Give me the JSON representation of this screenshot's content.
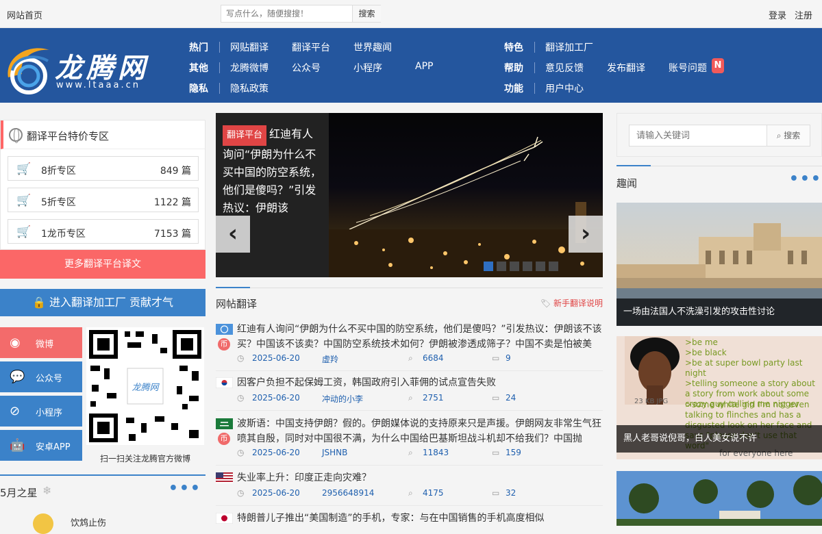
{
  "topbar": {
    "home": "网站首页",
    "search_placeholder": "写点什么，随便搜搜！",
    "search_button": "搜索",
    "login": "登录",
    "register": "注册"
  },
  "logo": {
    "title": "龙腾网",
    "url": "www.ltaaa.cn"
  },
  "nav": {
    "row1": [
      "热门",
      "网贴翻译",
      "翻译平台",
      "世界趣闻",
      "特色",
      "翻译加工厂"
    ],
    "row2": [
      "其他",
      "龙腾微博",
      "公众号",
      "小程序",
      "APP",
      "帮助",
      "意见反馈",
      "发布翻译",
      "账号问题"
    ],
    "row3": [
      "隐私",
      "隐私政策",
      "功能",
      "用户中心"
    ],
    "badge": "N"
  },
  "promo": {
    "title": "翻译平台特价专区",
    "items": [
      {
        "name": "8折专区",
        "count": "849 篇"
      },
      {
        "name": "5折专区",
        "count": "1122 篇"
      },
      {
        "name": "1龙币专区",
        "count": "7153 篇"
      }
    ],
    "more": "更多翻译平台译文",
    "enter": "进入翻译加工厂 贡献才气"
  },
  "social": [
    "微博",
    "公众号",
    "小程序",
    "安卓APP"
  ],
  "qr_caption": "扫一扫关注龙腾官方微博",
  "star": {
    "title": "5月之星",
    "name": "饮鸩止伤"
  },
  "slider": {
    "tag": "翻译平台",
    "text": "红迪有人询问“伊朗为什么不买中国的防空系统，他们是傻吗？”引发热议：伊朗该"
  },
  "section": {
    "title": "网帖翻译",
    "guide": "新手翻译说明"
  },
  "news": [
    {
      "title": "红迪有人询问“伊朗为什么不买中国的防空系统，他们是傻吗？”引发热议：伊朗该不该买？中国该不该卖？中国防空系统技术如何？伊朗被渗透成筛子？中国不卖是怕被美",
      "date": "2025-06-20",
      "author": "虚羚",
      "views": "6684",
      "comments": "9",
      "coin": "币"
    },
    {
      "title": "因客户负担不起保姆工资，韩国政府引入菲佣的试点宣告失败",
      "date": "2025-06-20",
      "author": "冲动的小李",
      "views": "2751",
      "comments": "24"
    },
    {
      "title": "波斯语：中国支持伊朗？假的。伊朗媒体说的支持原来只是声援。伊朗网友非常生气狂喷其自殷，同时对中国很不满，为什么中国给巴基斯坦战斗机却不给我们？中国抛",
      "date": "2025-06-20",
      "author": "JSHNB",
      "views": "11843",
      "comments": "159",
      "coin": "币"
    },
    {
      "title": "失业率上升：印度正走向灾难？",
      "date": "2025-06-20",
      "author": "2956648914",
      "views": "4175",
      "comments": "32"
    },
    {
      "title": "特朗普儿子推出“美国制造”的手机，专家：与在中国销售的手机高度相似"
    }
  ],
  "right": {
    "search_placeholder": "请输入关键词",
    "search_button": "搜索",
    "section": "趣闻",
    "cards": [
      {
        "caption": "一场由法国人不洗澡引发的攻击性讨论"
      },
      {
        "caption": "黑人老哥说倪哥，白人美女说不许",
        "greentext": [
          ">be me",
          ">be black",
          ">be at super bowl party last night",
          ">telling someone a story about a story from work about some crazy guy calling me nigger",
          ">some white girl I'm not even talking to flinches and has a disgusted look on her face and says \"please don't use that word\"",
          "for everyone here"
        ],
        "img_label": "23 KB JPG"
      }
    ]
  },
  "colors": {
    "nav_bg": "#24569e",
    "accent_red": "#fb6767",
    "accent_blue": "#3b82c9"
  }
}
